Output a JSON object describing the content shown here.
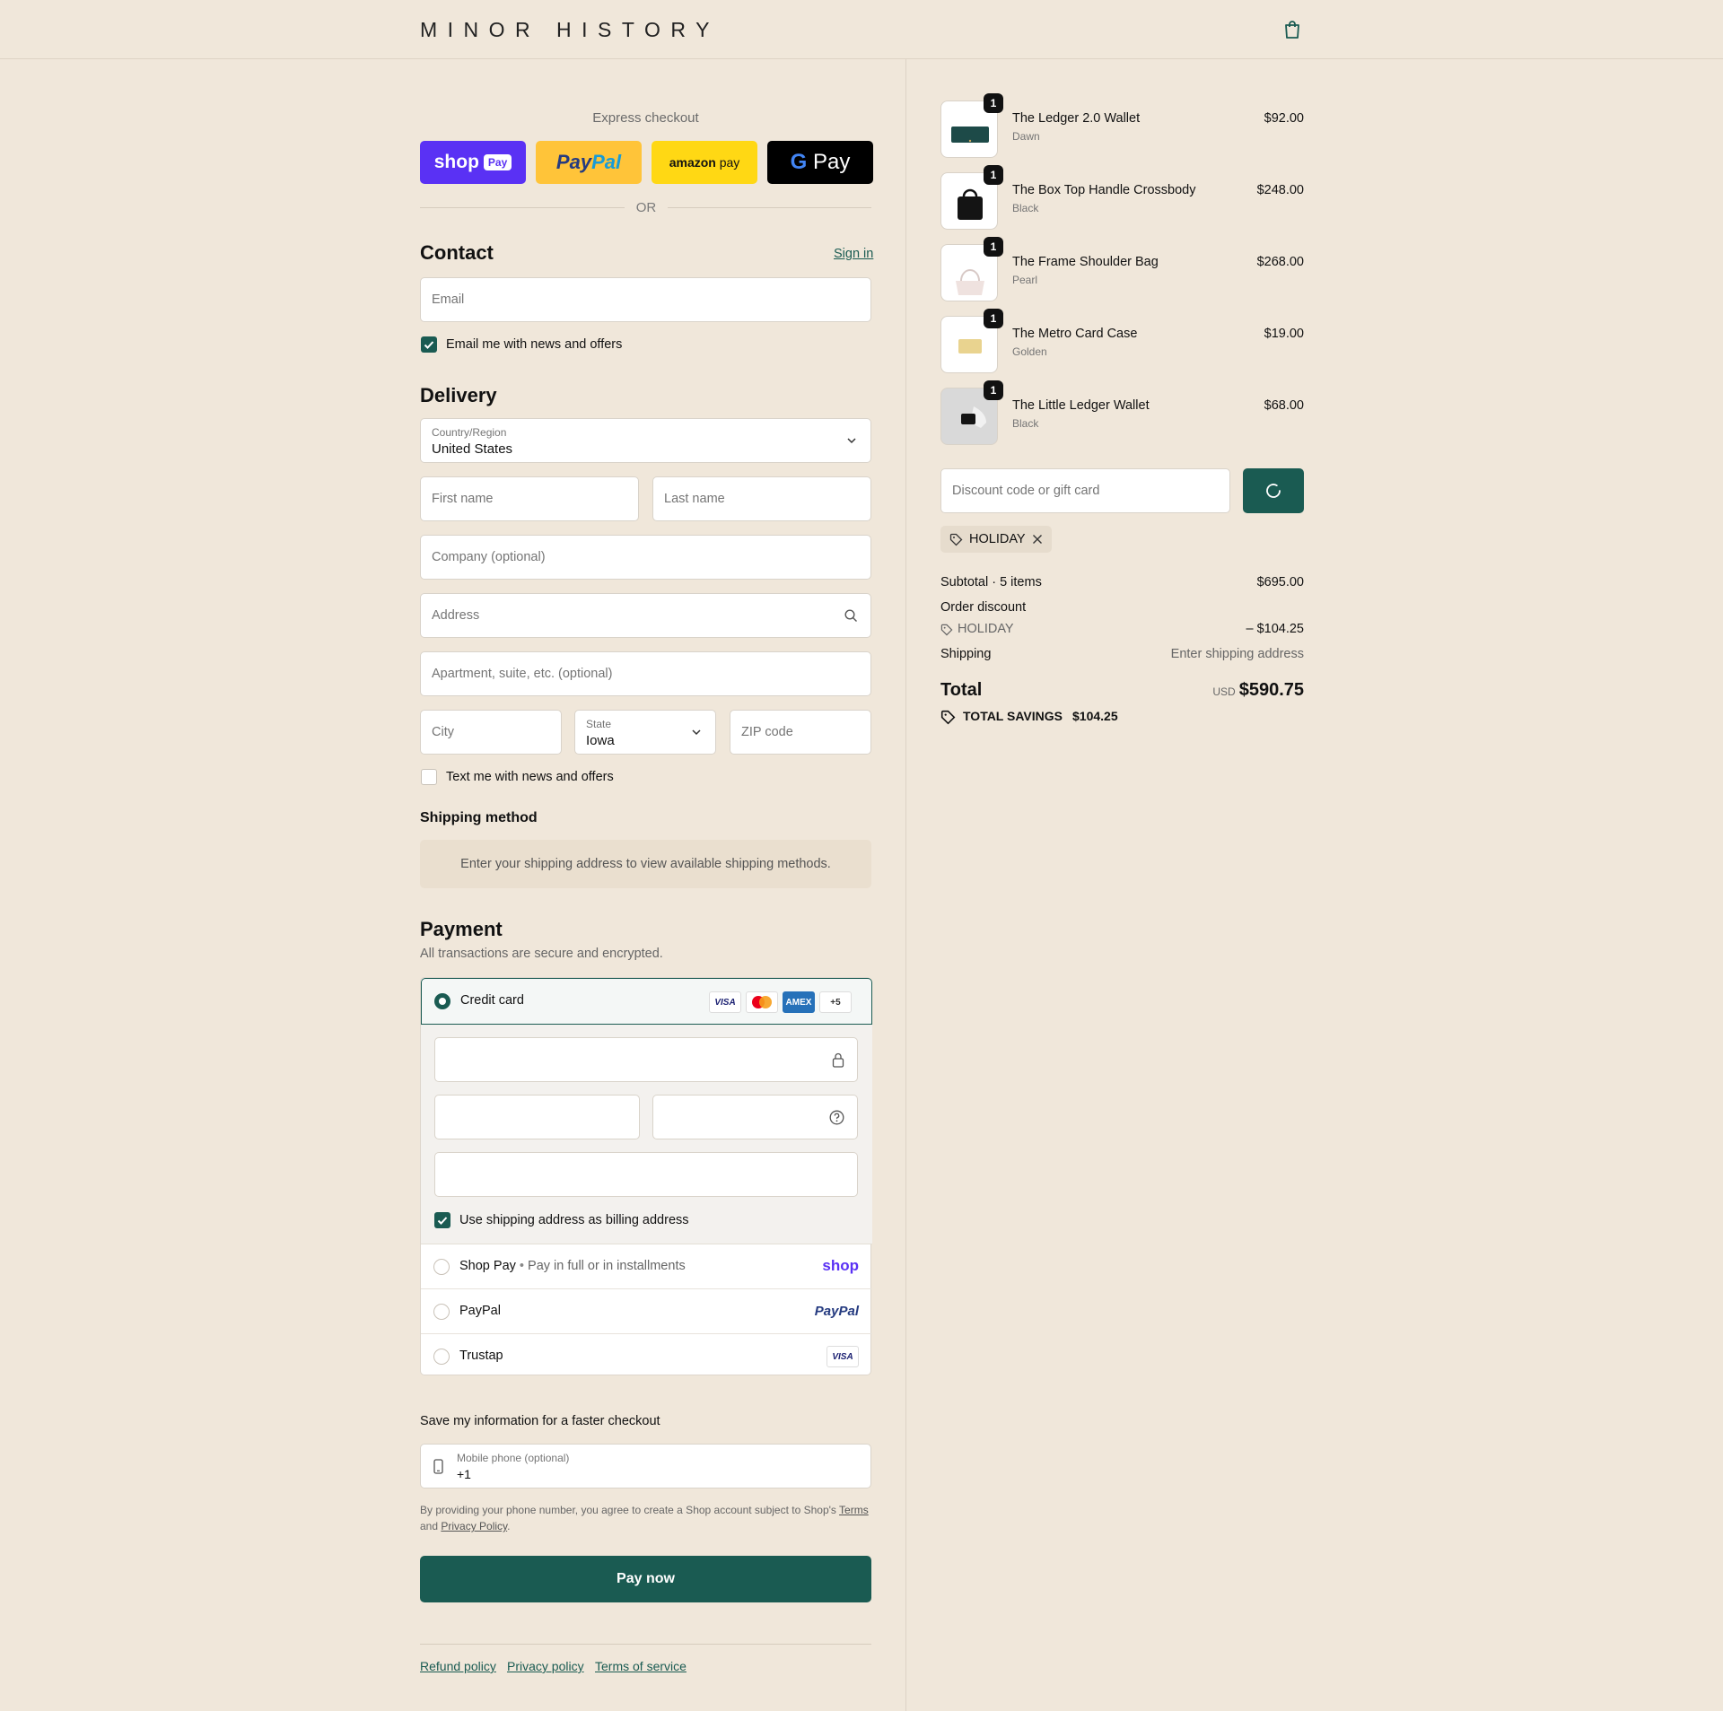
{
  "header": {
    "logo": "MINOR HISTORY",
    "cart_icon": "shopping-bag-icon"
  },
  "express": {
    "title": "Express checkout",
    "buttons": [
      {
        "name": "Shop Pay",
        "color": "#5a31f4"
      },
      {
        "name": "PayPal",
        "color": "#ffc439"
      },
      {
        "name": "amazon pay",
        "color": "#ffd814"
      },
      {
        "name": "G Pay",
        "color": "#000000"
      }
    ],
    "or": "OR"
  },
  "contact": {
    "title": "Contact",
    "signin": "Sign in",
    "email_placeholder": "Email",
    "news_checkbox": "Email me with news and offers",
    "news_checked": true
  },
  "delivery": {
    "title": "Delivery",
    "country_label": "Country/Region",
    "country_value": "United States",
    "first_name": "First name",
    "last_name": "Last name",
    "company": "Company (optional)",
    "address": "Address",
    "apartment": "Apartment, suite, etc. (optional)",
    "city": "City",
    "state_label": "State",
    "state_value": "Iowa",
    "zip": "ZIP code",
    "text_checkbox": "Text me with news and offers",
    "text_checked": false
  },
  "shipping_method": {
    "title": "Shipping method",
    "info": "Enter your shipping address to view available shipping methods."
  },
  "payment": {
    "title": "Payment",
    "subtitle": "All transactions are secure and encrypted.",
    "credit_card": "Credit card",
    "card_logos": [
      "VISA",
      "MC",
      "AMEX",
      "+5"
    ],
    "billing_checkbox": "Use shipping address as billing address",
    "billing_checked": true,
    "methods": [
      {
        "label": "Shop Pay",
        "sub": "Pay in full or in installments",
        "logo": "shop"
      },
      {
        "label": "PayPal",
        "sub": "",
        "logo": "PayPal"
      },
      {
        "label": "Trustap",
        "sub": "",
        "logo": "VISA"
      }
    ]
  },
  "save_info": {
    "title": "Save my information for a faster checkout",
    "phone_label": "Mobile phone (optional)",
    "phone_value": "+1",
    "disclaimer_prefix": "By providing your phone number, you agree to create a Shop account subject to Shop's ",
    "terms": "Terms",
    "and": "and ",
    "privacy": "Privacy Policy",
    "period": "."
  },
  "pay_now": "Pay now",
  "footer": {
    "links": [
      "Refund policy",
      "Privacy policy",
      "Terms of service"
    ]
  },
  "order": {
    "items": [
      {
        "name": "The Ledger 2.0 Wallet",
        "variant": "Dawn",
        "price": "$92.00",
        "qty": "1"
      },
      {
        "name": "The Box Top Handle Crossbody",
        "variant": "Black",
        "price": "$248.00",
        "qty": "1"
      },
      {
        "name": "The Frame Shoulder Bag",
        "variant": "Pearl",
        "price": "$268.00",
        "qty": "1"
      },
      {
        "name": "The Metro Card Case",
        "variant": "Golden",
        "price": "$19.00",
        "qty": "1"
      },
      {
        "name": "The Little Ledger Wallet",
        "variant": "Black",
        "price": "$68.00",
        "qty": "1"
      }
    ],
    "discount_placeholder": "Discount code or gift card",
    "discount_tag": "HOLIDAY",
    "subtotal_label": "Subtotal · 5 items",
    "subtotal": "$695.00",
    "order_discount_label": "Order discount",
    "discount_code": "HOLIDAY",
    "discount_amount": "– $104.25",
    "shipping_label": "Shipping",
    "shipping_value": "Enter shipping address",
    "total_label": "Total",
    "currency": "USD",
    "total": "$590.75",
    "savings_label": "TOTAL SAVINGS",
    "savings": "$104.25"
  },
  "colors": {
    "accent": "#1a5b52",
    "background": "#f0e7da"
  }
}
